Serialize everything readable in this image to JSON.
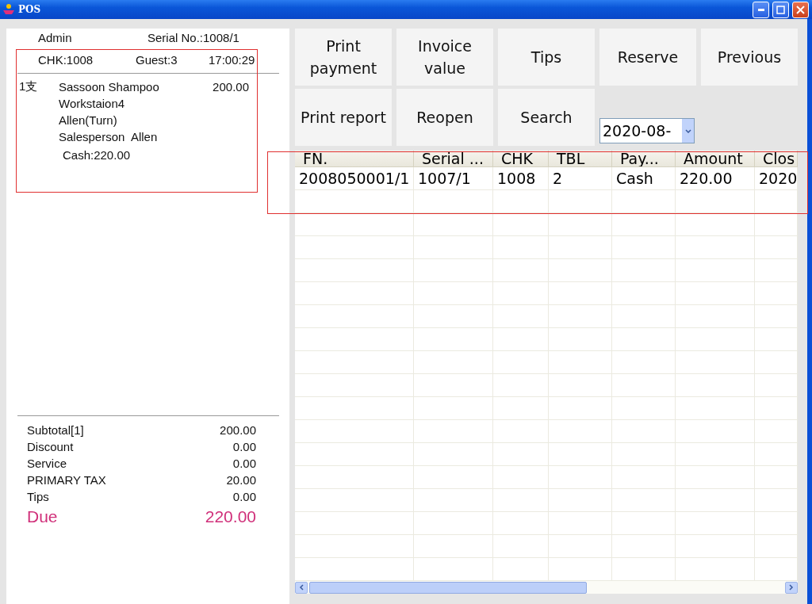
{
  "window": {
    "title": "POS"
  },
  "receipt": {
    "operator": "Admin",
    "serial": "Serial No.:1008/1",
    "check": "CHK:1008",
    "guests": "Guest:3",
    "time": "17:00:29",
    "items": [
      {
        "qty": "1支",
        "name": "Sassoon Shampoo",
        "price": "200.00",
        "details": [
          "Workstaion4",
          "Allen(Turn)",
          "Salesperson  Allen"
        ]
      }
    ],
    "payment": "Cash:220.00",
    "totals": [
      {
        "label": "Subtotal[1]",
        "value": "200.00"
      },
      {
        "label": "Discount",
        "value": "0.00"
      },
      {
        "label": "Service",
        "value": "0.00"
      },
      {
        "label": "PRIMARY TAX",
        "value": "20.00"
      },
      {
        "label": "Tips",
        "value": "0.00"
      }
    ],
    "due": {
      "label": "Due",
      "value": "220.00"
    }
  },
  "buttons": [
    "Print payment",
    "Invoice value",
    "Tips",
    "Reserve",
    "Previous",
    "Print report",
    "Reopen",
    "Search"
  ],
  "date_select": {
    "value": "2020-08-"
  },
  "table": {
    "columns": [
      "FN.",
      "Serial ...",
      "CHK",
      "TBL",
      "Pay...",
      "Amount",
      "Clos"
    ],
    "rows": [
      [
        "2008050001/1",
        "1007/1",
        "1008",
        "2",
        "Cash",
        "220.00",
        "2020"
      ]
    ]
  }
}
